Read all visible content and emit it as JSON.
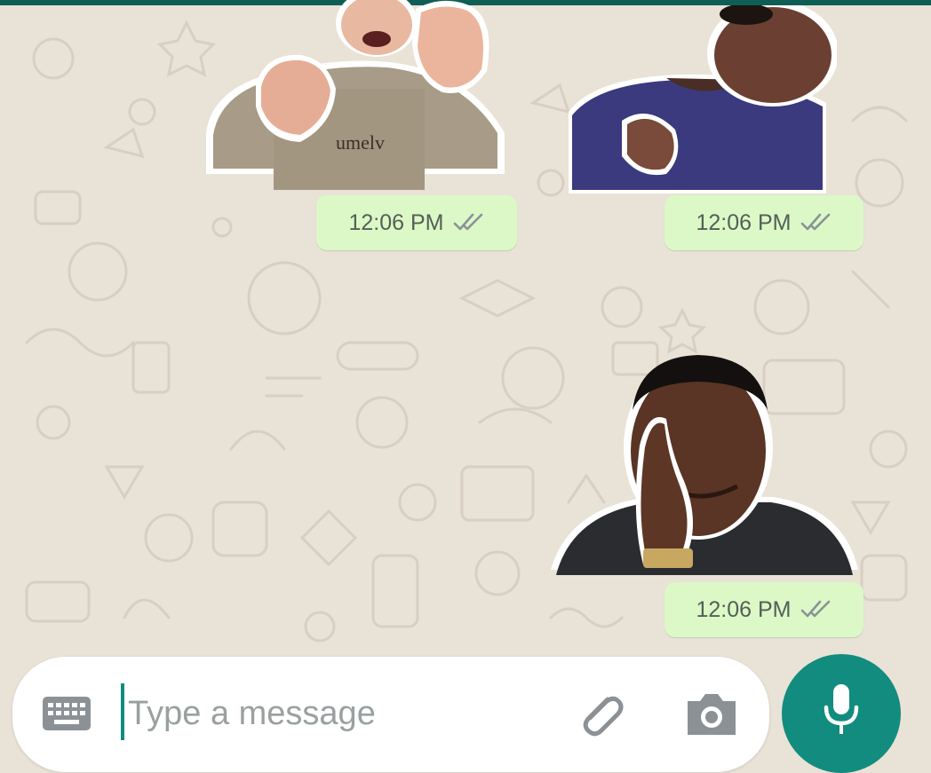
{
  "colors": {
    "header_teal": "#0f5e55",
    "wallpaper": "#e9e2d7",
    "outgoing_bubble": "#dcf8c6",
    "accent_green": "#128c7e"
  },
  "messages": [
    {
      "type": "sticker",
      "sticker_name": "waving-man-sticker",
      "time": "12:06 PM",
      "status": "read",
      "status_icon": "double-check-icon"
    },
    {
      "type": "sticker",
      "sticker_name": "confused-girl-sticker",
      "time": "12:06 PM",
      "status": "read",
      "status_icon": "double-check-icon"
    },
    {
      "type": "sticker",
      "sticker_name": "thinking-man-sticker",
      "time": "12:06 PM",
      "status": "read",
      "status_icon": "double-check-icon"
    }
  ],
  "composer": {
    "placeholder": "Type a message",
    "value": "",
    "icons": [
      "keyboard-icon",
      "paperclip-icon",
      "camera-icon",
      "microphone-icon"
    ]
  }
}
